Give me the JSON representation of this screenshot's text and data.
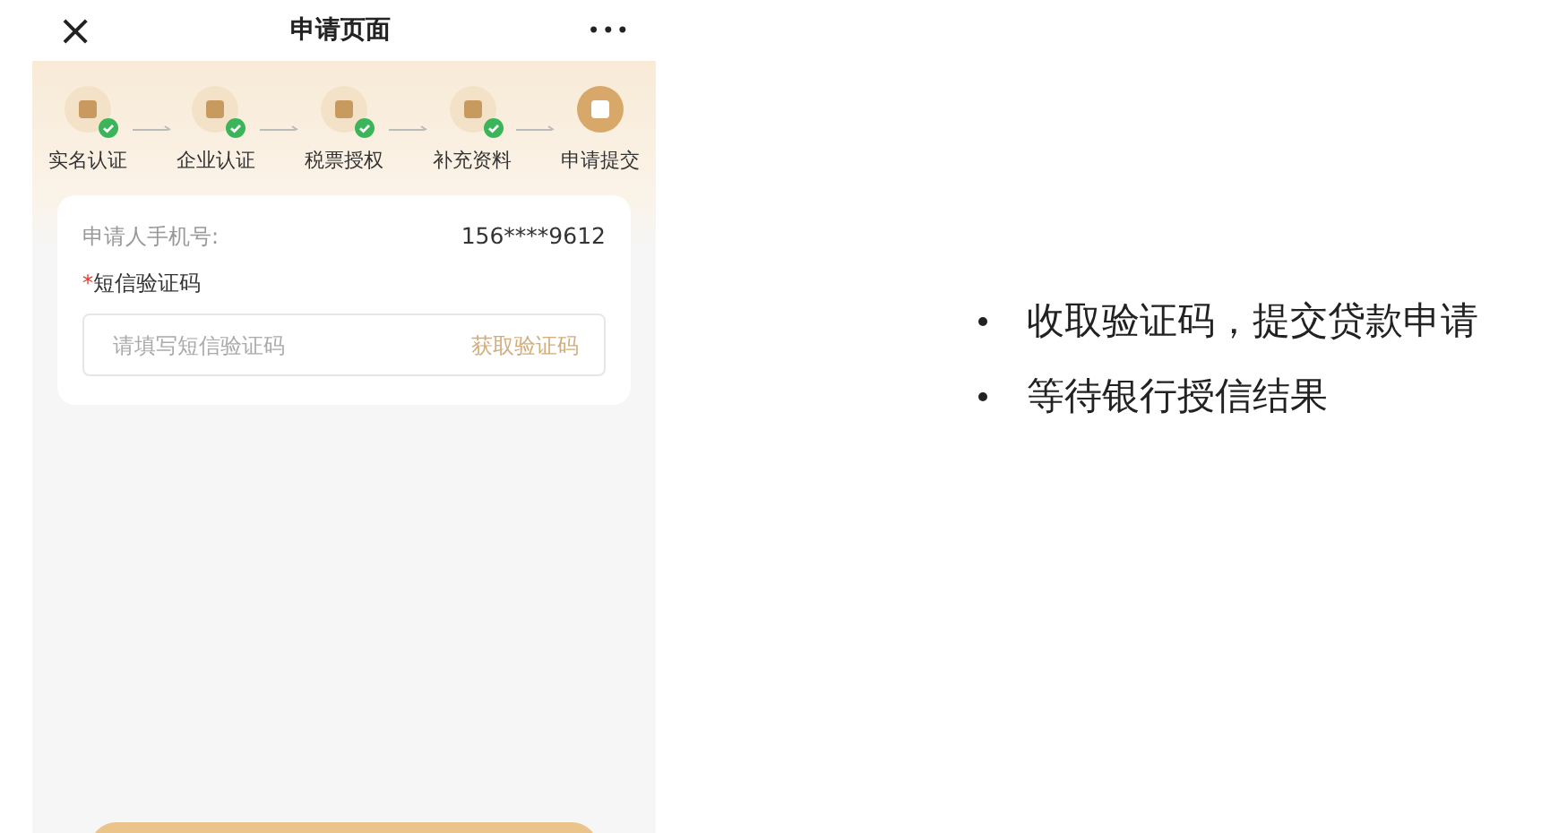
{
  "header": {
    "close": "×",
    "title": "申请页面",
    "more": "•••"
  },
  "steps": [
    {
      "label": "实名认证",
      "done": true,
      "current": false
    },
    {
      "label": "企业认证",
      "done": true,
      "current": false
    },
    {
      "label": "税票授权",
      "done": true,
      "current": false
    },
    {
      "label": "补充资料",
      "done": true,
      "current": false
    },
    {
      "label": "申请提交",
      "done": false,
      "current": true
    }
  ],
  "form": {
    "phone_label": "申请人手机号:",
    "phone_value": "156****9612",
    "code_required_mark": "*",
    "code_label": "短信验证码",
    "code_placeholder": "请填写短信验证码",
    "get_code": "获取验证码"
  },
  "bullets": [
    "收取验证码，提交贷款申请",
    "等待银行授信结果"
  ]
}
